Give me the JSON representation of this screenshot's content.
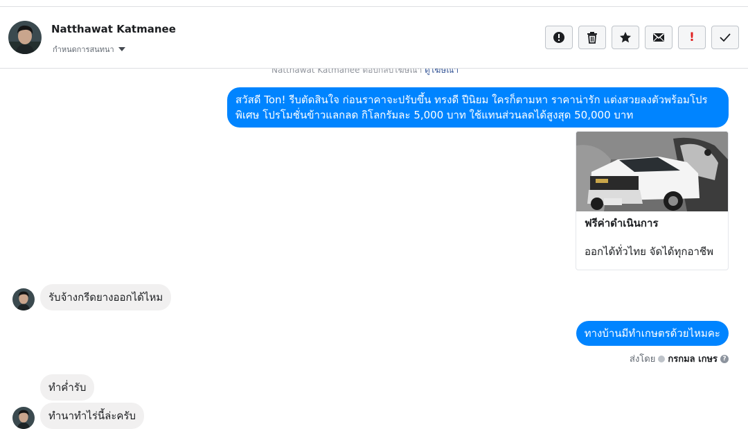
{
  "header": {
    "contact_name": "Natthawat Katmanee",
    "status_label": "กำหนดการสนทนา",
    "avatar_icon": "user-avatar",
    "toolbar": [
      {
        "icon": "report-icon",
        "tooltip": ""
      },
      {
        "icon": "trash-icon",
        "tooltip": ""
      },
      {
        "icon": "star-icon",
        "tooltip": ""
      },
      {
        "icon": "mail-icon",
        "tooltip": ""
      },
      {
        "icon": "exclamation-icon",
        "label": "!"
      },
      {
        "icon": "check-icon",
        "tooltip": ""
      }
    ]
  },
  "thread": {
    "note_text": "Natthawat Katmanee ตอบกลับโฆษณา",
    "note_link": "ดูโฆษณา",
    "messages": [
      {
        "direction": "out",
        "text": "สวัสดี Ton! รีบตัดสินใจ ก่อนราคาจะปรับขึ้น ทรงดี ปีนิยม ใครก็ตามหา ราคาน่ารัก แต่งสวยลงตัวพร้อมโปรพิเศษ โปรโมชั่นข้าวแลกลด กิโลกรัมละ 5,000 บาท ใช้แทนส่วนลดได้สูงสุด 50,000 บาท"
      },
      {
        "direction": "out",
        "type": "card",
        "title": "ฟรีค่าดำเนินการ",
        "subtitle": "ออกได้ทั่วไทย จัดได้ทุกอาชีพ"
      },
      {
        "direction": "in",
        "text": "รับจ้างกรีดยางออกได้ไหม"
      },
      {
        "direction": "out",
        "text": "ทางบ้านมีทำเกษตรด้วยไหมคะ"
      },
      {
        "direction": "in",
        "text": "ทำค่ำรับ"
      },
      {
        "direction": "in",
        "text": "ทำนาทำไร่นี้ล่ะครับ"
      }
    ],
    "sent_by_label": "ส่งโดย",
    "sent_by_name": "กรกมล เกษร"
  },
  "colors": {
    "outgoing_bubble": "#0084ff",
    "incoming_bubble": "#f1f0f0",
    "alert_red": "#e02020"
  }
}
